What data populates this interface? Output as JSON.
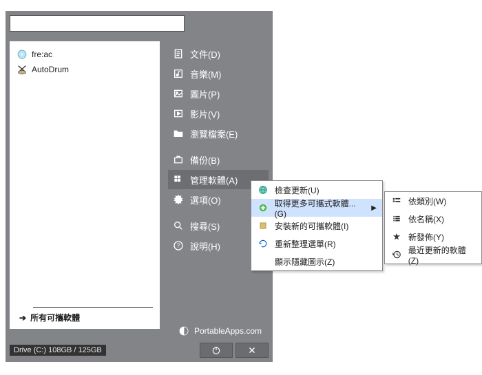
{
  "search": {
    "placeholder": ""
  },
  "apps": {
    "items": [
      {
        "name": "fre:ac"
      },
      {
        "name": "AutoDrum"
      }
    ],
    "all_label": "所有可攜軟體"
  },
  "side": {
    "documents": "文件(D)",
    "music": "音樂(M)",
    "pictures": "圖片(P)",
    "videos": "影片(V)",
    "explore": "瀏覽檔案(E)",
    "backup": "備份(B)",
    "manage": "管理軟體(A)",
    "options": "選項(O)",
    "search": "搜尋(S)",
    "help": "說明(H)"
  },
  "brand": "PortableApps.com",
  "drive": "Drive (C:) 108GB / 125GB",
  "submenu1": {
    "check_update": "檢查更新(U)",
    "get_more": "取得更多可攜式軟體...(G)",
    "install": "安裝新的可攜軟體(I)",
    "refresh": "重新整理選單(R)",
    "show_hidden": "顯示隱藏圖示(Z)"
  },
  "submenu2": {
    "by_category": "依類別(W)",
    "by_name": "依名稱(X)",
    "new_release": "新發佈(Y)",
    "recent": "最近更新的軟體(Z)"
  }
}
